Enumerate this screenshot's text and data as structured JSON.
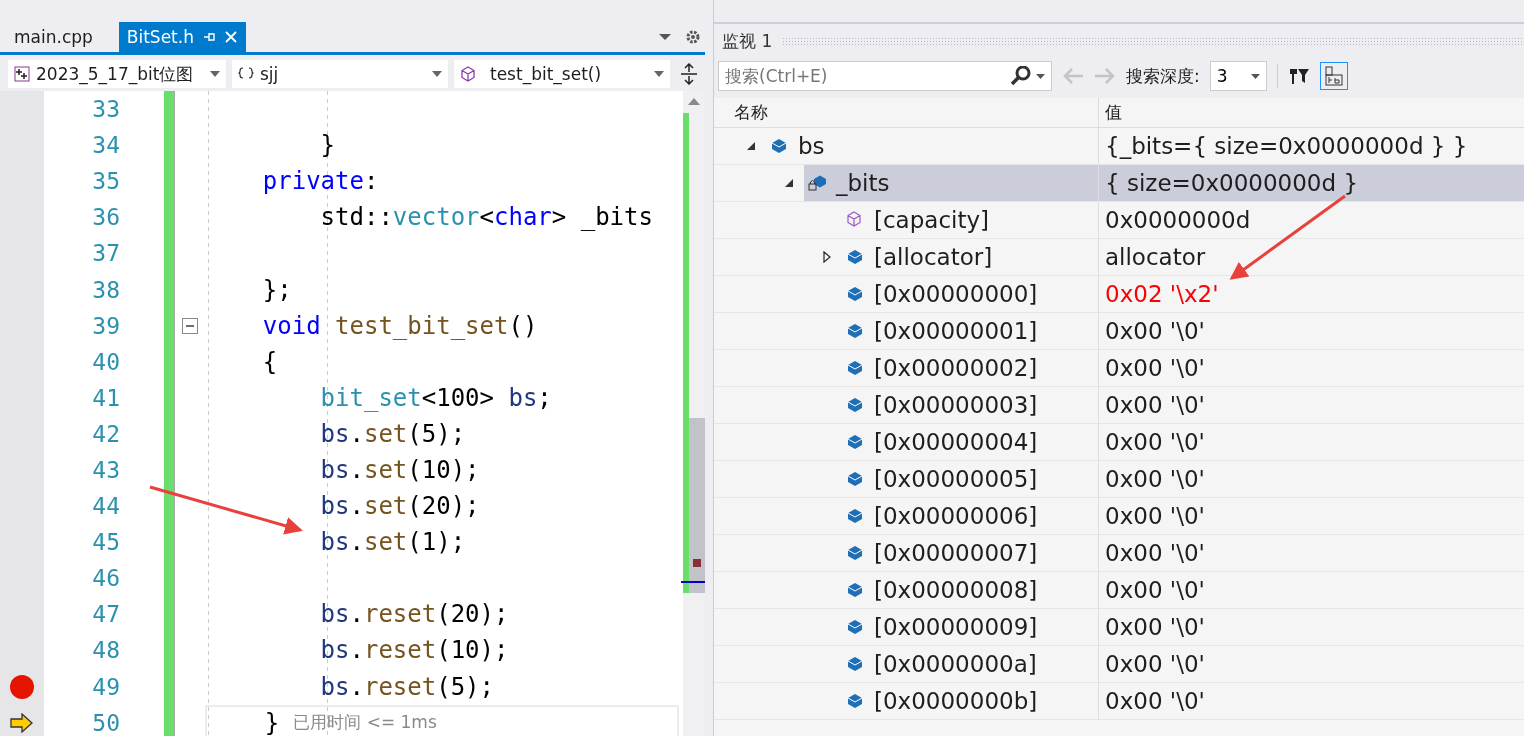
{
  "editor": {
    "tabs": [
      {
        "label": "main.cpp",
        "selected": false
      },
      {
        "label": "BitSet.h",
        "selected": true
      }
    ],
    "nav": {
      "project": "2023_5_17_bit位图",
      "scope": "sjj",
      "member": "test_bit_set()"
    },
    "lines": [
      {
        "number": "33"
      },
      {
        "number": "34",
        "tokens": [
          {
            "kind": "plain",
            "text": "        }"
          }
        ]
      },
      {
        "number": "35",
        "tokens": [
          {
            "kind": "keyword",
            "text": "    private"
          },
          {
            "kind": "plain",
            "text": ":"
          }
        ]
      },
      {
        "number": "36",
        "tokens": [
          {
            "kind": "plain",
            "text": "        std::"
          },
          {
            "kind": "type",
            "text": "vector"
          },
          {
            "kind": "plain",
            "text": "<"
          },
          {
            "kind": "keyword",
            "text": "char"
          },
          {
            "kind": "plain",
            "text": "> _bits"
          }
        ]
      },
      {
        "number": "37"
      },
      {
        "number": "38",
        "tokens": [
          {
            "kind": "plain",
            "text": "    };"
          }
        ]
      },
      {
        "number": "39",
        "fold": true,
        "tokens": [
          {
            "kind": "keyword",
            "text": "    void "
          },
          {
            "kind": "func",
            "text": "test_bit_set"
          },
          {
            "kind": "plain",
            "text": "()"
          }
        ]
      },
      {
        "number": "40",
        "tokens": [
          {
            "kind": "plain",
            "text": "    {"
          }
        ]
      },
      {
        "number": "41",
        "tokens": [
          {
            "kind": "type",
            "text": "        bit_set"
          },
          {
            "kind": "plain",
            "text": "<100> "
          },
          {
            "kind": "local",
            "text": "bs"
          },
          {
            "kind": "plain",
            "text": ";"
          }
        ]
      },
      {
        "number": "42",
        "tokens": [
          {
            "kind": "local",
            "text": "        bs"
          },
          {
            "kind": "plain",
            "text": "."
          },
          {
            "kind": "func",
            "text": "set"
          },
          {
            "kind": "plain",
            "text": "(5);"
          }
        ]
      },
      {
        "number": "43",
        "tokens": [
          {
            "kind": "local",
            "text": "        bs"
          },
          {
            "kind": "plain",
            "text": "."
          },
          {
            "kind": "func",
            "text": "set"
          },
          {
            "kind": "plain",
            "text": "(10);"
          }
        ]
      },
      {
        "number": "44",
        "tokens": [
          {
            "kind": "local",
            "text": "        bs"
          },
          {
            "kind": "plain",
            "text": "."
          },
          {
            "kind": "func",
            "text": "set"
          },
          {
            "kind": "plain",
            "text": "(20);"
          }
        ]
      },
      {
        "number": "45",
        "tokens": [
          {
            "kind": "local",
            "text": "        bs"
          },
          {
            "kind": "plain",
            "text": "."
          },
          {
            "kind": "func",
            "text": "set"
          },
          {
            "kind": "plain",
            "text": "(1);"
          }
        ]
      },
      {
        "number": "46"
      },
      {
        "number": "47",
        "tokens": [
          {
            "kind": "local",
            "text": "        bs"
          },
          {
            "kind": "plain",
            "text": "."
          },
          {
            "kind": "func",
            "text": "reset"
          },
          {
            "kind": "plain",
            "text": "(20);"
          }
        ]
      },
      {
        "number": "48",
        "tokens": [
          {
            "kind": "local",
            "text": "        bs"
          },
          {
            "kind": "plain",
            "text": "."
          },
          {
            "kind": "func",
            "text": "reset"
          },
          {
            "kind": "plain",
            "text": "(10);"
          }
        ]
      },
      {
        "number": "49",
        "breakpoint": true,
        "tokens": [
          {
            "kind": "local",
            "text": "        bs"
          },
          {
            "kind": "plain",
            "text": "."
          },
          {
            "kind": "func",
            "text": "reset"
          },
          {
            "kind": "plain",
            "text": "(5);"
          }
        ]
      },
      {
        "number": "50",
        "current": true,
        "tokens": [
          {
            "kind": "plain",
            "text": "    }"
          }
        ],
        "perf_tip": "已用时间 <= 1ms"
      }
    ]
  },
  "watch": {
    "title": "监视 1",
    "search": {
      "placeholder": "搜索(Ctrl+E)"
    },
    "depth_label": "搜索深度:",
    "depth": "3",
    "columns": [
      "名称",
      "值"
    ],
    "rows": [
      {
        "name": "bs",
        "value": "{_bits={ size=0x0000000d } }",
        "kind": "object",
        "expanded": true,
        "selected": false,
        "changed": false,
        "children": [
          {
            "name": "_bits",
            "value": "{ size=0x0000000d }",
            "kind": "private",
            "expanded": true,
            "selected": true,
            "changed": false,
            "children": [
              {
                "name": "[capacity]",
                "value": "0x0000000d",
                "kind": "property",
                "selected": false,
                "changed": false
              },
              {
                "name": "[allocator]",
                "value": "allocator",
                "kind": "object",
                "expanded": false,
                "selected": false,
                "changed": false
              },
              {
                "name": "[0x00000000]",
                "value": "0x02 '\\x2'",
                "kind": "object",
                "selected": false,
                "changed": true
              },
              {
                "name": "[0x00000001]",
                "value": "0x00 '\\0'",
                "kind": "object",
                "selected": false,
                "changed": false
              },
              {
                "name": "[0x00000002]",
                "value": "0x00 '\\0'",
                "kind": "object",
                "selected": false,
                "changed": false
              },
              {
                "name": "[0x00000003]",
                "value": "0x00 '\\0'",
                "kind": "object",
                "selected": false,
                "changed": false
              },
              {
                "name": "[0x00000004]",
                "value": "0x00 '\\0'",
                "kind": "object",
                "selected": false,
                "changed": false
              },
              {
                "name": "[0x00000005]",
                "value": "0x00 '\\0'",
                "kind": "object",
                "selected": false,
                "changed": false
              },
              {
                "name": "[0x00000006]",
                "value": "0x00 '\\0'",
                "kind": "object",
                "selected": false,
                "changed": false
              },
              {
                "name": "[0x00000007]",
                "value": "0x00 '\\0'",
                "kind": "object",
                "selected": false,
                "changed": false
              },
              {
                "name": "[0x00000008]",
                "value": "0x00 '\\0'",
                "kind": "object",
                "selected": false,
                "changed": false
              },
              {
                "name": "[0x00000009]",
                "value": "0x00 '\\0'",
                "kind": "object",
                "selected": false,
                "changed": false
              },
              {
                "name": "[0x0000000a]",
                "value": "0x00 '\\0'",
                "kind": "object",
                "selected": false,
                "changed": false
              },
              {
                "name": "[0x0000000b]",
                "value": "0x00 '\\0'",
                "kind": "object",
                "selected": false,
                "changed": false
              }
            ]
          }
        ]
      }
    ]
  }
}
